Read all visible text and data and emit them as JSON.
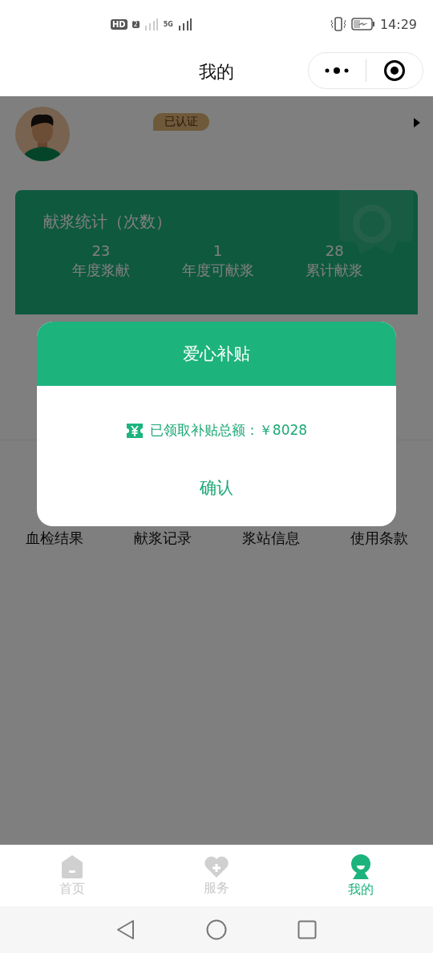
{
  "status_bar": {
    "hd": "HD",
    "sim": "2",
    "network": "5G",
    "time": "14:29"
  },
  "nav": {
    "title": "我的"
  },
  "profile": {
    "badge": "已认证"
  },
  "stats": {
    "title": "献浆统计（次数）",
    "items": [
      {
        "value": "23",
        "label": "年度浆献"
      },
      {
        "value": "1",
        "label": "年度可献浆"
      },
      {
        "value": "28",
        "label": "累计献浆"
      }
    ]
  },
  "shortcuts": [
    "血检结果",
    "献浆记录",
    "浆站信息",
    "使用条款"
  ],
  "dialog": {
    "title": "爱心补贴",
    "message": "已领取补贴总额：￥8028",
    "confirm": "确认"
  },
  "tabs": [
    {
      "label": "首页",
      "kind": "home",
      "selected": false
    },
    {
      "label": "服务",
      "kind": "service",
      "selected": false
    },
    {
      "label": "我的",
      "kind": "me",
      "selected": true
    }
  ]
}
